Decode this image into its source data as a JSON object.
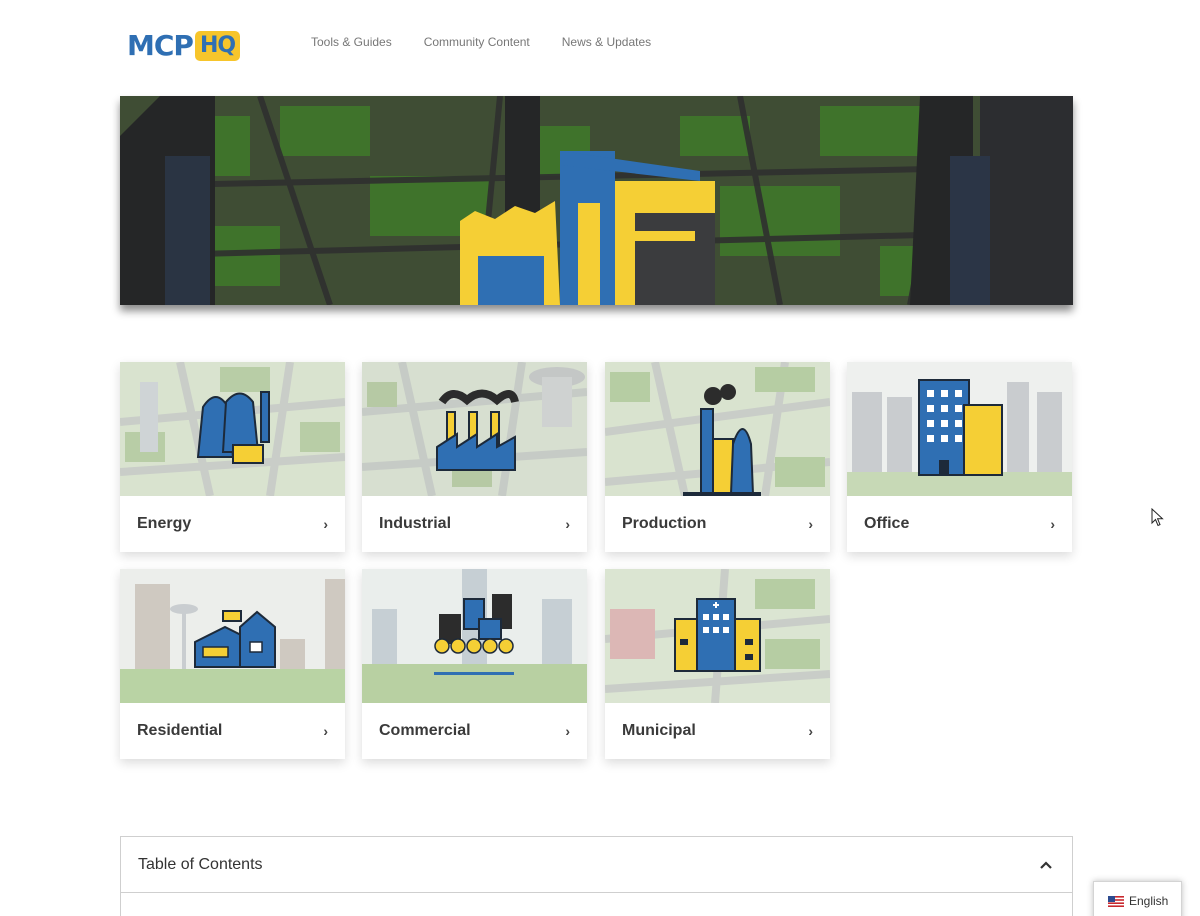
{
  "brand": {
    "logo_left": "MCP",
    "logo_right": "HQ",
    "primary_color": "#2f6fb3",
    "accent_color": "#f7c52b"
  },
  "nav": {
    "items": [
      {
        "label": "Tools & Guides"
      },
      {
        "label": "Community Content"
      },
      {
        "label": "News & Updates"
      }
    ]
  },
  "hero": {
    "icon": "city-buildings-icon"
  },
  "categories": [
    {
      "label": "Energy",
      "icon": "power-plant-icon"
    },
    {
      "label": "Industrial",
      "icon": "factory-icon"
    },
    {
      "label": "Production",
      "icon": "production-plant-icon"
    },
    {
      "label": "Office",
      "icon": "office-building-icon"
    },
    {
      "label": "Residential",
      "icon": "house-icon"
    },
    {
      "label": "Commercial",
      "icon": "shops-icon"
    },
    {
      "label": "Municipal",
      "icon": "hospital-icon"
    }
  ],
  "chevron_glyph": "›",
  "toc": {
    "title": "Table of Contents"
  },
  "language": {
    "label": "English",
    "icon": "us-flag-icon"
  }
}
